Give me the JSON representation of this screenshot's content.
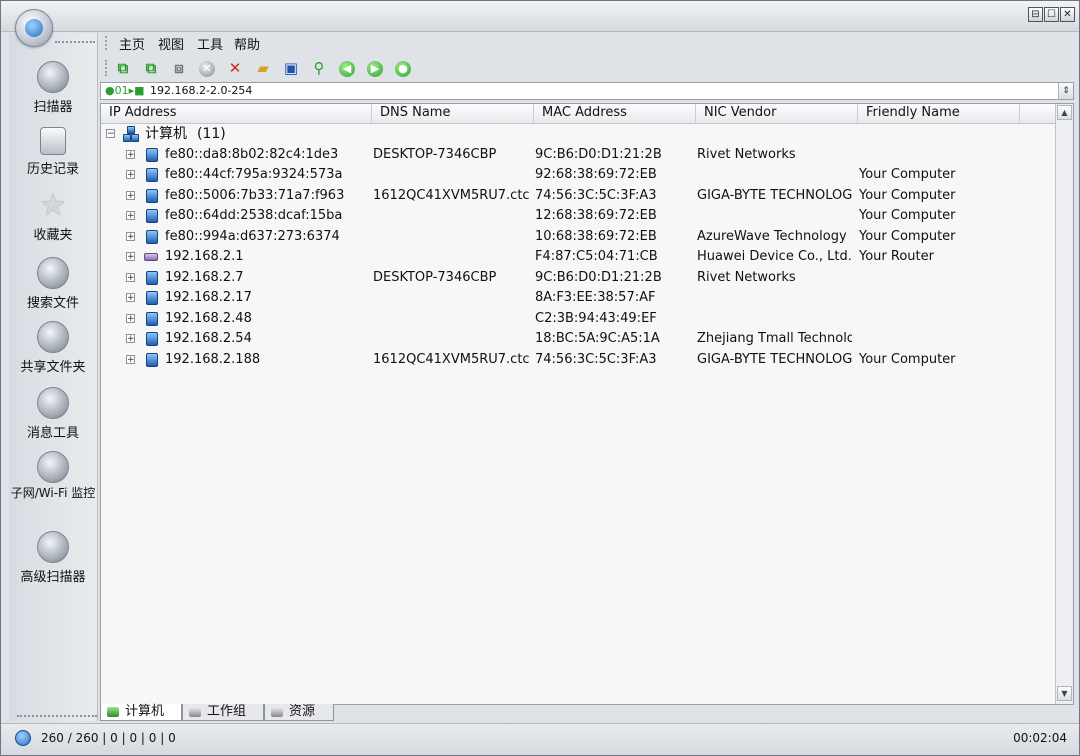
{
  "window": {
    "buttons": [
      "⊟",
      "☐",
      "✕"
    ]
  },
  "sidebar": {
    "items": [
      {
        "label": "扫描器",
        "icon": "scanner-icon"
      },
      {
        "label": "历史记录",
        "icon": "history-icon"
      },
      {
        "label": "收藏夹",
        "icon": "favorites-star-icon"
      },
      {
        "label": "搜索文件",
        "icon": "search-files-icon"
      },
      {
        "label": "共享文件夹",
        "icon": "shared-folder-icon"
      },
      {
        "label": "消息工具",
        "icon": "message-icon"
      },
      {
        "label": "子网/Wi-Fi 监控",
        "icon": "subnet-monitor-icon"
      },
      {
        "label": "高级扫描器",
        "icon": "advanced-scanner-icon"
      }
    ]
  },
  "menu": [
    "主页",
    "视图",
    "工具",
    "帮助"
  ],
  "address": {
    "prefix": "●01▸■",
    "value": "192.168.2-2.0-254"
  },
  "columns": [
    "IP Address",
    "DNS Name",
    "MAC Address",
    "NIC Vendor",
    "Friendly Name"
  ],
  "group": {
    "label": "计算机",
    "count": "(11)"
  },
  "rows": [
    {
      "ip": "fe80::da8:8b02:82c4:1de3",
      "dns": "DESKTOP-7346CBP",
      "mac": "9C:B6:D0:D1:21:2B",
      "vendor": "Rivet Networks",
      "friendly": ""
    },
    {
      "ip": "fe80::44cf:795a:9324:573a",
      "dns": "",
      "mac": "92:68:38:69:72:EB",
      "vendor": "",
      "friendly": "Your Computer"
    },
    {
      "ip": "fe80::5006:7b33:71a7:f963",
      "dns": "1612QC41XVM5RU7.ctc",
      "mac": "74:56:3C:5C:3F:A3",
      "vendor": "GIGA-BYTE TECHNOLOGY",
      "friendly": "Your Computer"
    },
    {
      "ip": "fe80::64dd:2538:dcaf:15ba",
      "dns": "",
      "mac": "12:68:38:69:72:EB",
      "vendor": "",
      "friendly": "Your Computer"
    },
    {
      "ip": "fe80::994a:d637:273:6374",
      "dns": "",
      "mac": "10:68:38:69:72:EB",
      "vendor": "AzureWave Technology I",
      "friendly": "Your Computer"
    },
    {
      "ip": "192.168.2.1",
      "dns": "",
      "mac": "F4:87:C5:04:71:CB",
      "vendor": "Huawei Device Co., Ltd.",
      "friendly": "Your Router",
      "router": true
    },
    {
      "ip": "192.168.2.7",
      "dns": "DESKTOP-7346CBP",
      "mac": "9C:B6:D0:D1:21:2B",
      "vendor": "Rivet Networks",
      "friendly": ""
    },
    {
      "ip": "192.168.2.17",
      "dns": "",
      "mac": "8A:F3:EE:38:57:AF",
      "vendor": "",
      "friendly": ""
    },
    {
      "ip": "192.168.2.48",
      "dns": "",
      "mac": "C2:3B:94:43:49:EF",
      "vendor": "",
      "friendly": ""
    },
    {
      "ip": "192.168.2.54",
      "dns": "",
      "mac": "18:BC:5A:9C:A5:1A",
      "vendor": "Zhejiang Tmall Technolo",
      "friendly": ""
    },
    {
      "ip": "192.168.2.188",
      "dns": "1612QC41XVM5RU7.ctc",
      "mac": "74:56:3C:5C:3F:A3",
      "vendor": "GIGA-BYTE TECHNOLOGY",
      "friendly": "Your Computer"
    }
  ],
  "tabs": [
    "计算机",
    "工作组",
    "资源"
  ],
  "status": {
    "text": "260 / 260  |  0  |  0  |  0  |  0",
    "time": "00:02:04"
  }
}
